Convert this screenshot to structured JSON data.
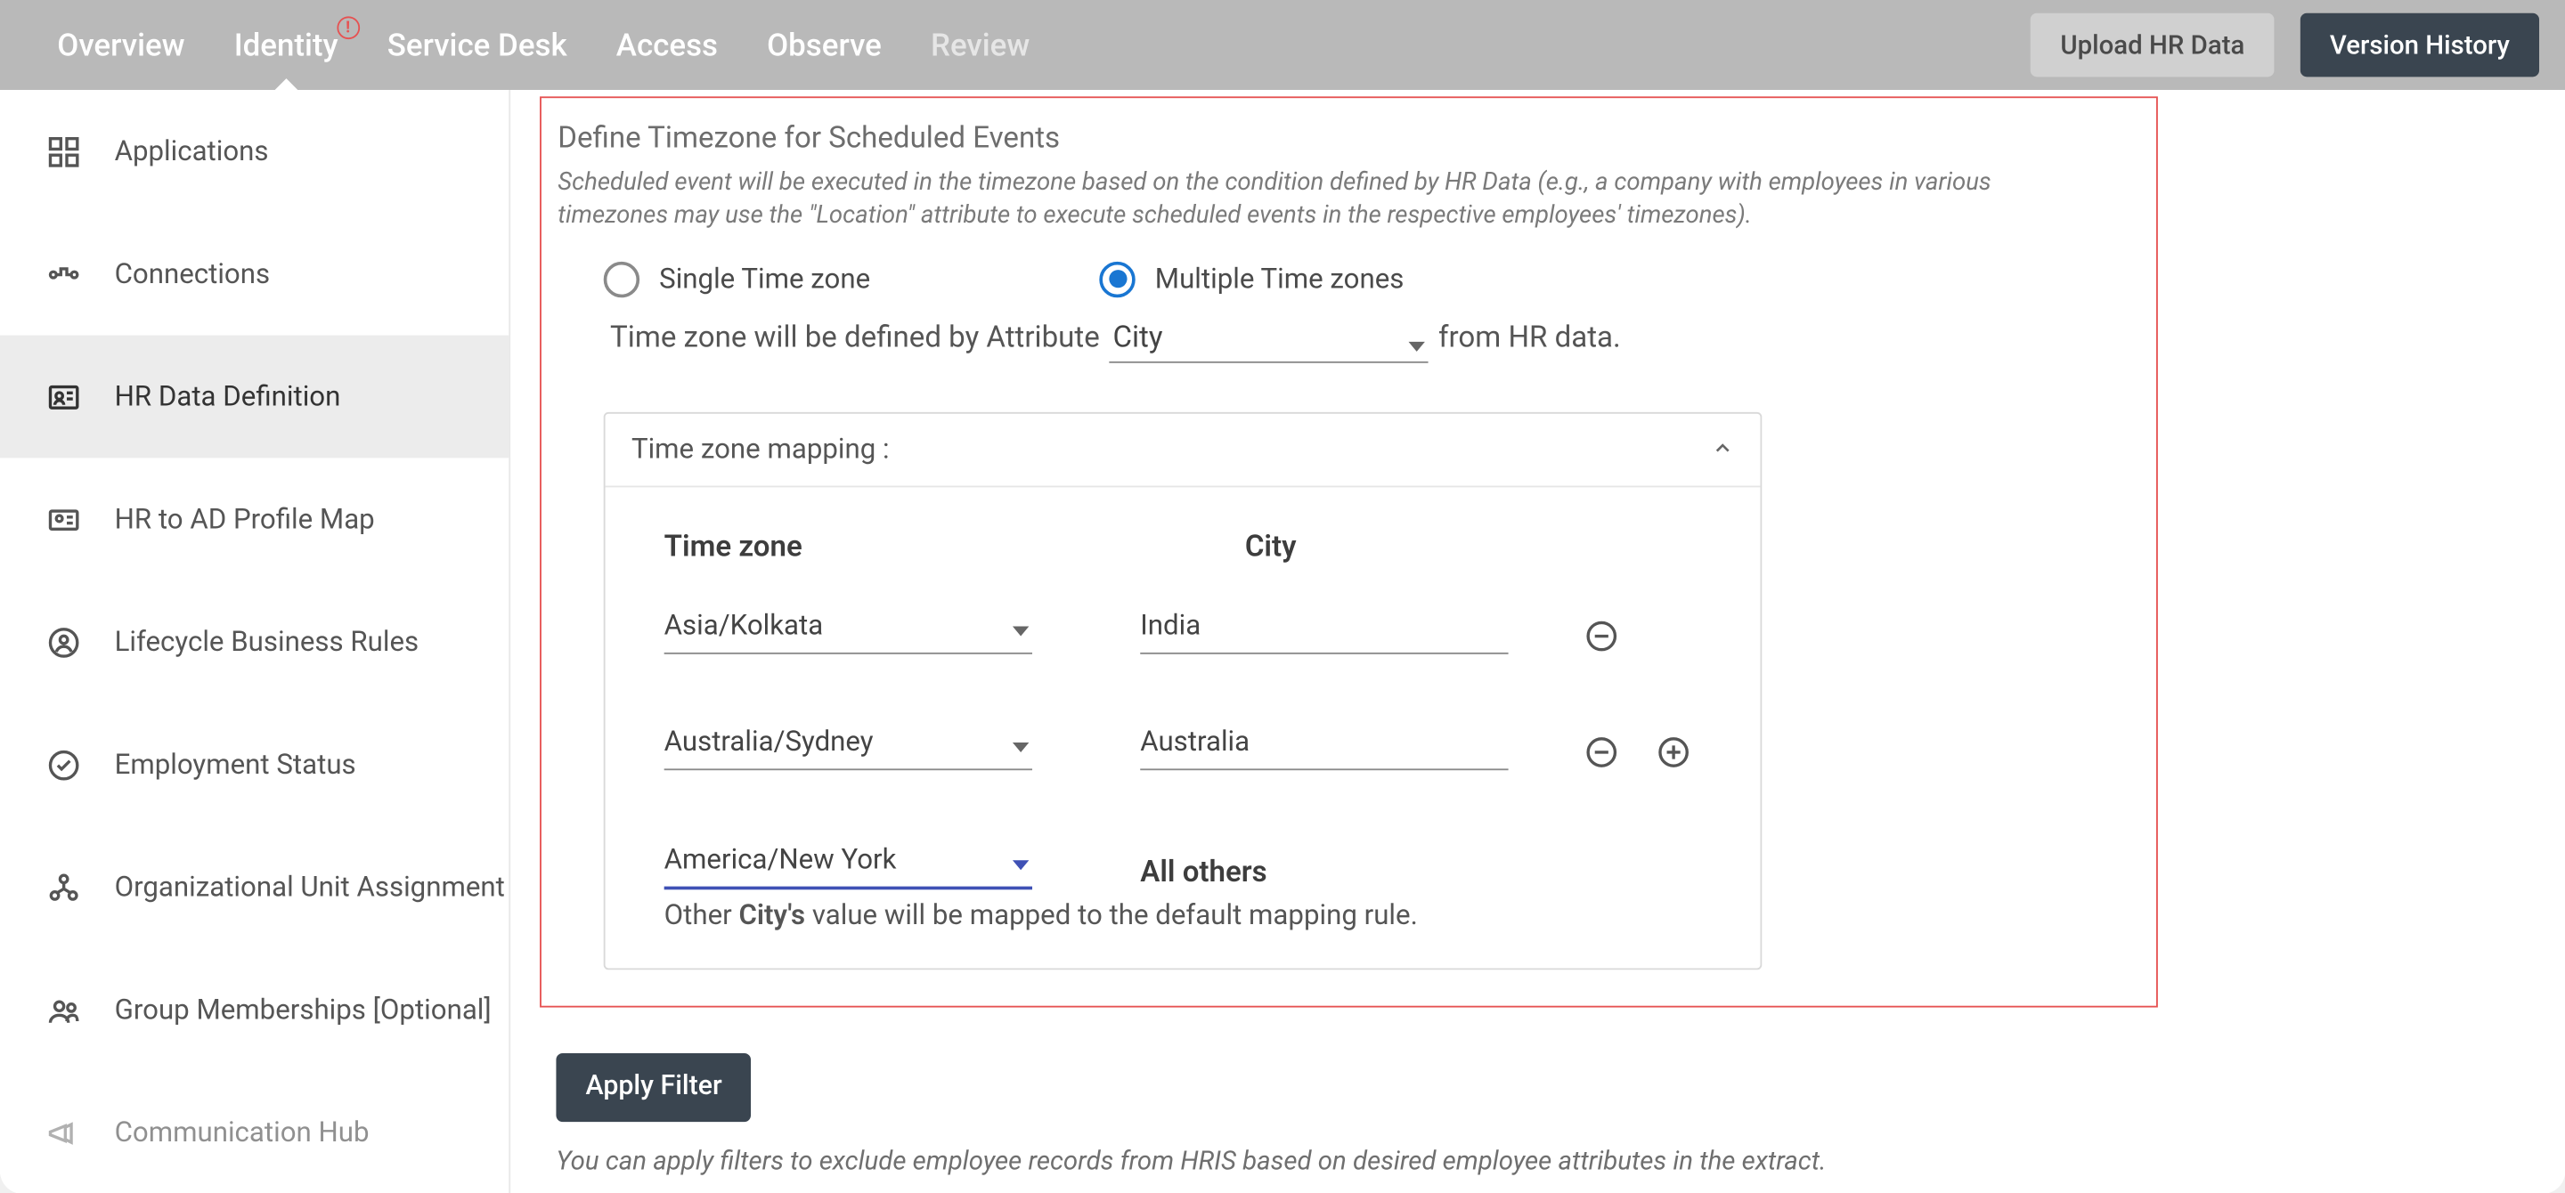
{
  "topbar": {
    "tabs": [
      "Overview",
      "Identity",
      "Service Desk",
      "Access",
      "Observe",
      "Review"
    ],
    "upload": "Upload HR Data",
    "version": "Version History"
  },
  "sidebar": {
    "items": [
      "Applications",
      "Connections",
      "HR Data Definition",
      "HR to AD Profile Map",
      "Lifecycle Business Rules",
      "Employment Status",
      "Organizational Unit Assignment",
      "Group Memberships [Optional]",
      "Communication Hub"
    ]
  },
  "panel": {
    "title": "Define Timezone for Scheduled Events",
    "desc": "Scheduled event will be executed in the timezone based on the condition defined by HR Data (e.g., a company with employees in various timezones may use the \"Location\" attribute to execute scheduled events in the respective employees' timezones).",
    "radio_single": "Single Time zone",
    "radio_multiple": "Multiple Time zones",
    "sentence_pre": "Time zone will be defined by Attribute",
    "attribute_value": "City",
    "sentence_post": "from HR data."
  },
  "mapping": {
    "header": "Time zone mapping :",
    "col_tz": "Time zone",
    "col_city": "City",
    "rows": [
      {
        "tz": "Asia/Kolkata",
        "city": "India"
      },
      {
        "tz": "Australia/Sydney",
        "city": "Australia"
      }
    ],
    "default_tz": "America/New York",
    "all_others": "All others",
    "note_pre": "Other ",
    "note_bold": "City's",
    "note_post": " value will be mapped to the default mapping rule."
  },
  "filter": {
    "apply": "Apply Filter",
    "desc": "You can apply filters to exclude employee records from HRIS based on desired employee attributes in the extract."
  }
}
